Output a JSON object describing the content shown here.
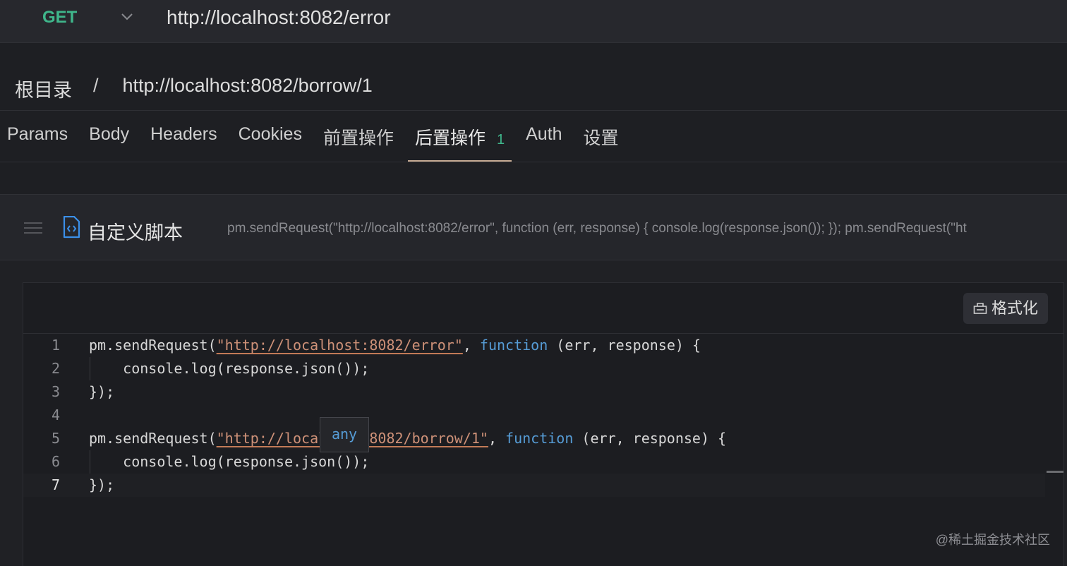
{
  "request": {
    "method": "GET",
    "url": "http://localhost:8082/error"
  },
  "breadcrumb": {
    "root": "根目录",
    "separator": "/",
    "current": "http://localhost:8082/borrow/1"
  },
  "tabs": [
    {
      "label": "Params"
    },
    {
      "label": "Body"
    },
    {
      "label": "Headers"
    },
    {
      "label": "Cookies"
    },
    {
      "label": "前置操作"
    },
    {
      "label": "后置操作",
      "badge": "1",
      "active": true
    },
    {
      "label": "Auth"
    },
    {
      "label": "设置"
    }
  ],
  "script": {
    "title": "自定义脚本",
    "summary": "pm.sendRequest(\"http://localhost:8082/error\", function (err, response) { console.log(response.json()); }); pm.sendRequest(\"ht",
    "format_label": "格式化"
  },
  "code": {
    "line_numbers": [
      "1",
      "2",
      "3",
      "4",
      "5",
      "6",
      "7"
    ],
    "l1_a": "pm.sendRequest(",
    "l1_str": "\"http://localhost:8082/error\"",
    "l1_b": ", ",
    "l1_kw": "function",
    "l1_c": " (err, response) {",
    "l2": "    console.log(response.json());",
    "l3": "});",
    "l5_a": "pm.sendRequest(",
    "l5_str": "\"http://localhost:8082/borrow/1\"",
    "l5_b": ", ",
    "l5_kw": "function",
    "l5_c": " (err, response) {",
    "l6": "    console.log(response.json());",
    "l7": "});"
  },
  "tooltip": "any",
  "watermark": "@稀土掘金技术社区",
  "colors": {
    "method": "#3fb68b",
    "accent_tab_underline": "#c6ab93",
    "string": "#ce9178",
    "keyword": "#569cd6"
  },
  "icons": [
    "chevron-down-icon",
    "drag-handle-icon",
    "script-file-icon",
    "format-icon"
  ]
}
